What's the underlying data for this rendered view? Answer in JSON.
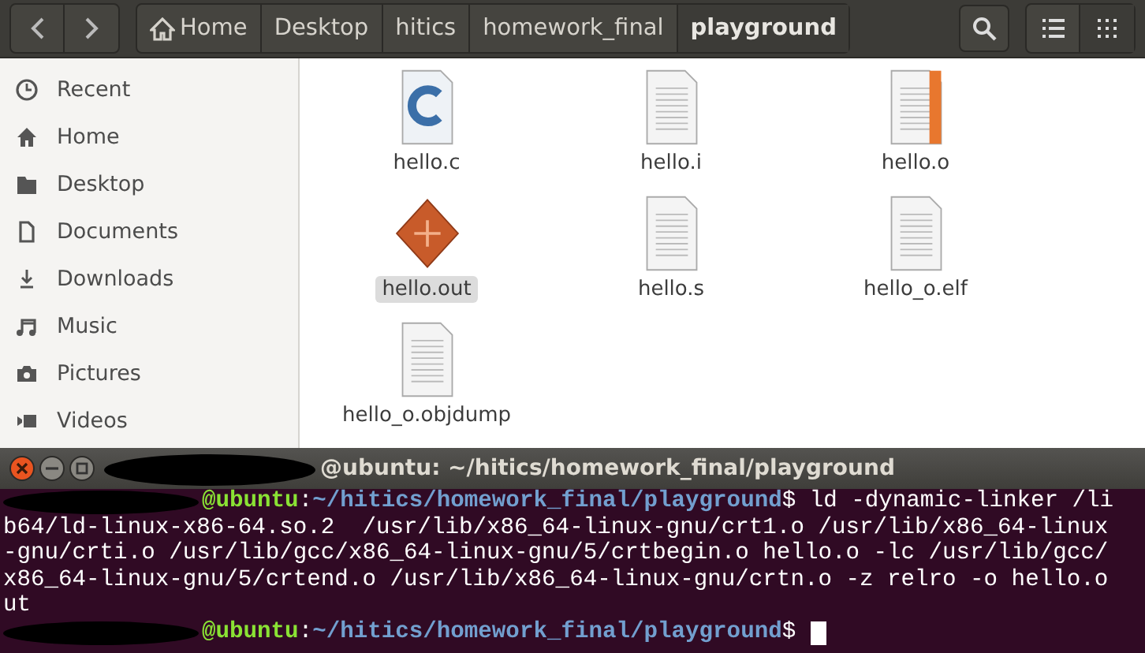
{
  "toolbar": {
    "breadcrumbs": [
      {
        "label": "Home",
        "kind": "home",
        "selected": false
      },
      {
        "label": "Desktop",
        "kind": "folder",
        "selected": false
      },
      {
        "label": "hitics",
        "kind": "folder",
        "selected": false
      },
      {
        "label": "homework_final",
        "kind": "folder",
        "selected": false
      },
      {
        "label": "playground",
        "kind": "folder",
        "selected": true
      }
    ]
  },
  "sidebar": {
    "items": [
      {
        "label": "Recent",
        "kind": "recent"
      },
      {
        "label": "Home",
        "kind": "home"
      },
      {
        "label": "Desktop",
        "kind": "desktop"
      },
      {
        "label": "Documents",
        "kind": "documents"
      },
      {
        "label": "Downloads",
        "kind": "downloads"
      },
      {
        "label": "Music",
        "kind": "music"
      },
      {
        "label": "Pictures",
        "kind": "pictures"
      },
      {
        "label": "Videos",
        "kind": "videos"
      }
    ]
  },
  "files": [
    {
      "name": "hello.c",
      "kind": "c-source",
      "selected": false
    },
    {
      "name": "hello.i",
      "kind": "text",
      "selected": false
    },
    {
      "name": "hello.o",
      "kind": "object",
      "selected": false
    },
    {
      "name": "hello.out",
      "kind": "executable",
      "selected": true
    },
    {
      "name": "hello.s",
      "kind": "text",
      "selected": false
    },
    {
      "name": "hello_o.elf",
      "kind": "text",
      "selected": false
    },
    {
      "name": "hello_o.objdump",
      "kind": "text",
      "selected": false
    }
  ],
  "terminal": {
    "title": "@ubuntu: ~/hitics/homework_final/playground",
    "lines": [
      {
        "kind": "prompt",
        "host": "@ubuntu",
        "separator": ":",
        "path": "~/hitics/homework_final/playground",
        "symbol": "$",
        "command": "ld -dynamic-linker /li"
      },
      {
        "kind": "output",
        "text": "b64/ld-linux-x86-64.so.2  /usr/lib/x86_64-linux-gnu/crt1.o /usr/lib/x86_64-linux"
      },
      {
        "kind": "output",
        "text": "-gnu/crti.o /usr/lib/gcc/x86_64-linux-gnu/5/crtbegin.o hello.o -lc /usr/lib/gcc/"
      },
      {
        "kind": "output",
        "text": "x86_64-linux-gnu/5/crtend.o /usr/lib/x86_64-linux-gnu/crtn.o -z relro -o hello.o"
      },
      {
        "kind": "output",
        "text": "ut"
      },
      {
        "kind": "prompt",
        "host": "@ubuntu",
        "separator": ":",
        "path": "~/hitics/homework_final/playground",
        "symbol": "$",
        "cursor": true
      }
    ]
  }
}
